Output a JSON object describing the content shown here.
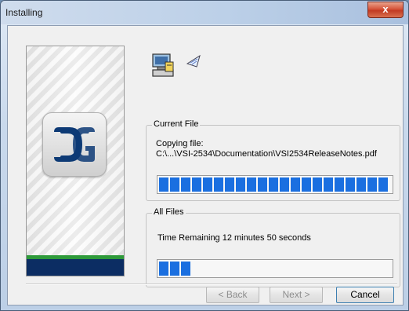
{
  "window": {
    "title": "Installing",
    "close_label": "x"
  },
  "current_file": {
    "group_label": "Current File",
    "copying_label": "Copying file:",
    "path": "C:\\...\\VSI-2534\\Documentation\\VSI2534ReleaseNotes.pdf",
    "progress_fraction": 1.0
  },
  "all_files": {
    "group_label": "All Files",
    "time_remaining": "Time Remaining 12 minutes 50 seconds",
    "progress_fraction": 0.15
  },
  "buttons": {
    "back": "< Back",
    "next": "Next >",
    "cancel": "Cancel"
  },
  "icons": {
    "setup": "computer-setup-icon",
    "paper": "flying-paper-icon",
    "folder": "folder-icon",
    "logo": "dg-logo-icon"
  },
  "colors": {
    "progress": "#1a6fe0",
    "banner_green": "#2e9a3a",
    "banner_blue": "#0c2d63"
  }
}
